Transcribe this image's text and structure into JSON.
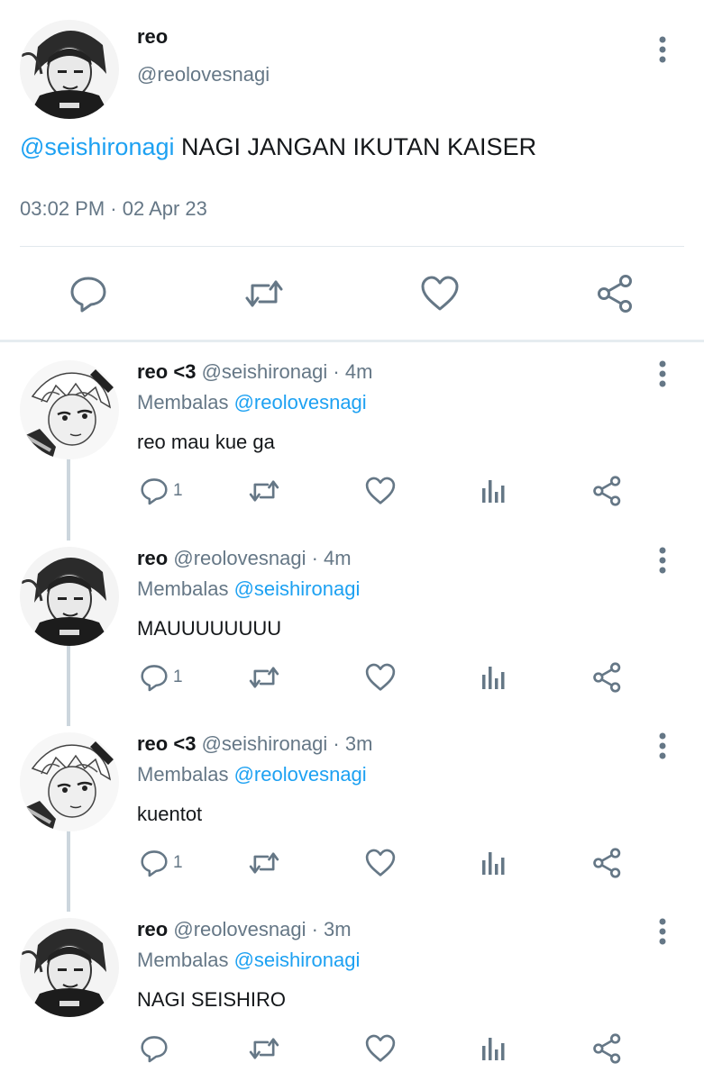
{
  "tweet": {
    "name": "reo",
    "handle": "@reolovesnagi",
    "mention": "@seishironagi",
    "text": " NAGI JANGAN IKUTAN KAISER",
    "timestamp": "03:02 PM · 02 Apr 23"
  },
  "replies": [
    {
      "name": "reo <3",
      "handle": "@seishironagi",
      "time": "· 4m",
      "replying_label": "Membalas ",
      "replying_to": "@reolovesnagi",
      "text": "reo mau kue ga",
      "reply_count": "1",
      "avatar": "white-hair-avatar"
    },
    {
      "name": "reo",
      "handle": "@reolovesnagi",
      "time": "· 4m",
      "replying_label": "Membalas ",
      "replying_to": "@seishironagi",
      "text": "MAUUUUUUUU",
      "reply_count": "1",
      "avatar": "dark-hair-avatar"
    },
    {
      "name": "reo <3",
      "handle": "@seishironagi",
      "time": "· 3m",
      "replying_label": "Membalas ",
      "replying_to": "@reolovesnagi",
      "text": "kuentot",
      "reply_count": "1",
      "avatar": "white-hair-avatar"
    },
    {
      "name": "reo",
      "handle": "@reolovesnagi",
      "time": "· 3m",
      "replying_label": "Membalas ",
      "replying_to": "@seishironagi",
      "text": "NAGI SEISHIRO",
      "reply_count": "",
      "avatar": "dark-hair-avatar"
    }
  ],
  "colors": {
    "accent": "#1da1f2",
    "muted": "#657786",
    "text": "#14171a",
    "divider": "#e1e8ed"
  }
}
